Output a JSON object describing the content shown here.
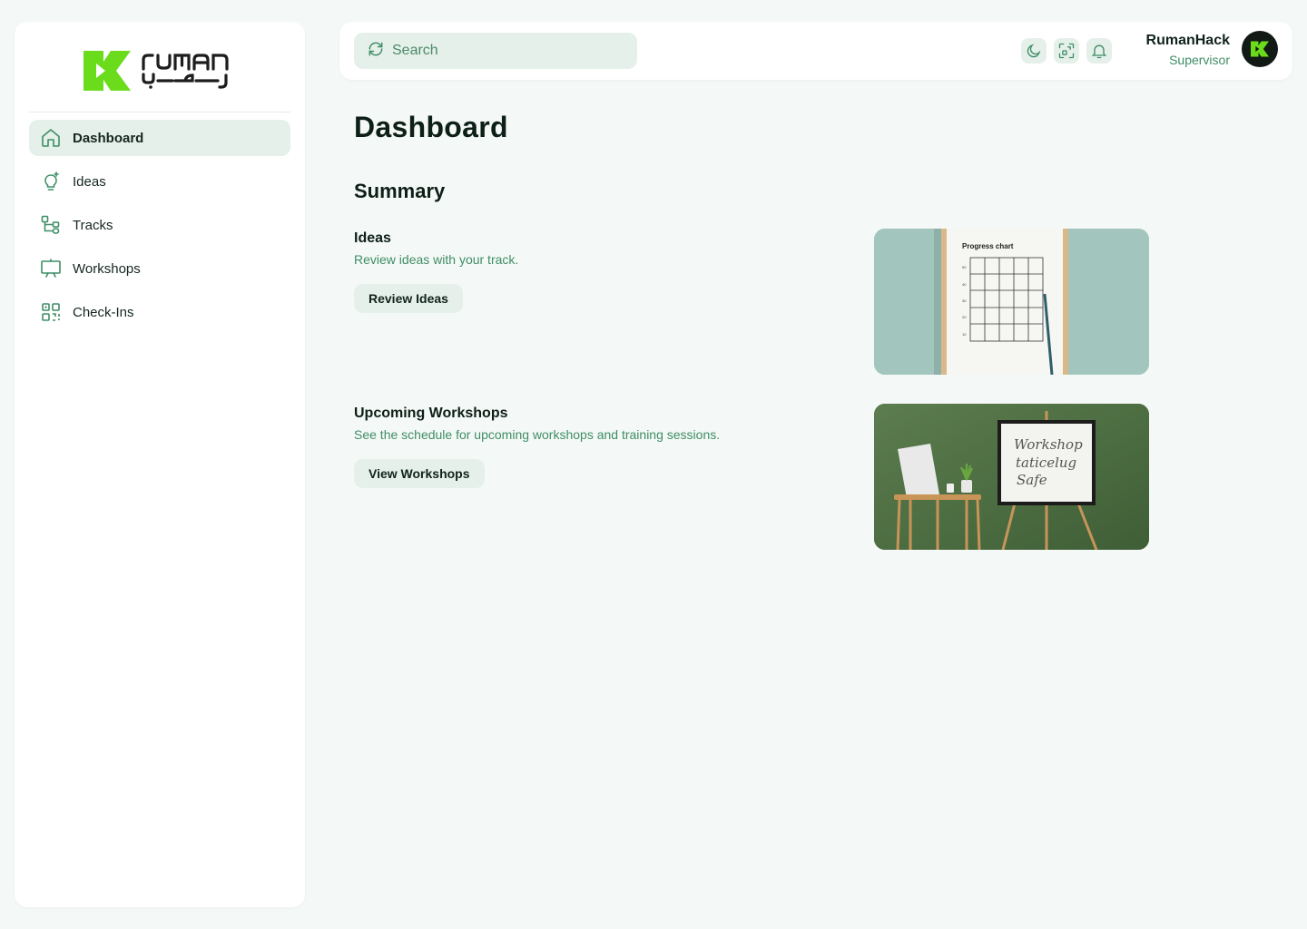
{
  "brand": {
    "name_latin": "ruman",
    "accent": "#6bdc1c"
  },
  "sidebar": {
    "items": [
      {
        "label": "Dashboard",
        "icon": "home-icon",
        "active": true
      },
      {
        "label": "Ideas",
        "icon": "lightbulb-icon",
        "active": false
      },
      {
        "label": "Tracks",
        "icon": "tracks-icon",
        "active": false
      },
      {
        "label": "Workshops",
        "icon": "presentation-icon",
        "active": false
      },
      {
        "label": "Check-Ins",
        "icon": "qr-code-icon",
        "active": false
      }
    ]
  },
  "header": {
    "search": {
      "placeholder": "Search"
    },
    "icons": [
      "moon-icon",
      "scan-icon",
      "bell-icon"
    ],
    "user": {
      "name": "RumanHack",
      "role": "Supervisor"
    }
  },
  "main": {
    "title": "Dashboard",
    "section_title": "Summary",
    "cards": [
      {
        "title": "Ideas",
        "description": "Review ideas with your track.",
        "button": "Review Ideas",
        "image_text": "Progress chart"
      },
      {
        "title": "Upcoming Workshops",
        "description": "See the schedule for upcoming workshops and training sessions.",
        "button": "View Workshops",
        "image_text": [
          "Workshop",
          "taticelug",
          "Safe"
        ]
      }
    ]
  },
  "colors": {
    "background": "#f4f8f6",
    "panel": "#ffffff",
    "accent_soft": "#e5f0ea",
    "accent_text": "#3f8e66",
    "dark_text": "#10231a"
  }
}
